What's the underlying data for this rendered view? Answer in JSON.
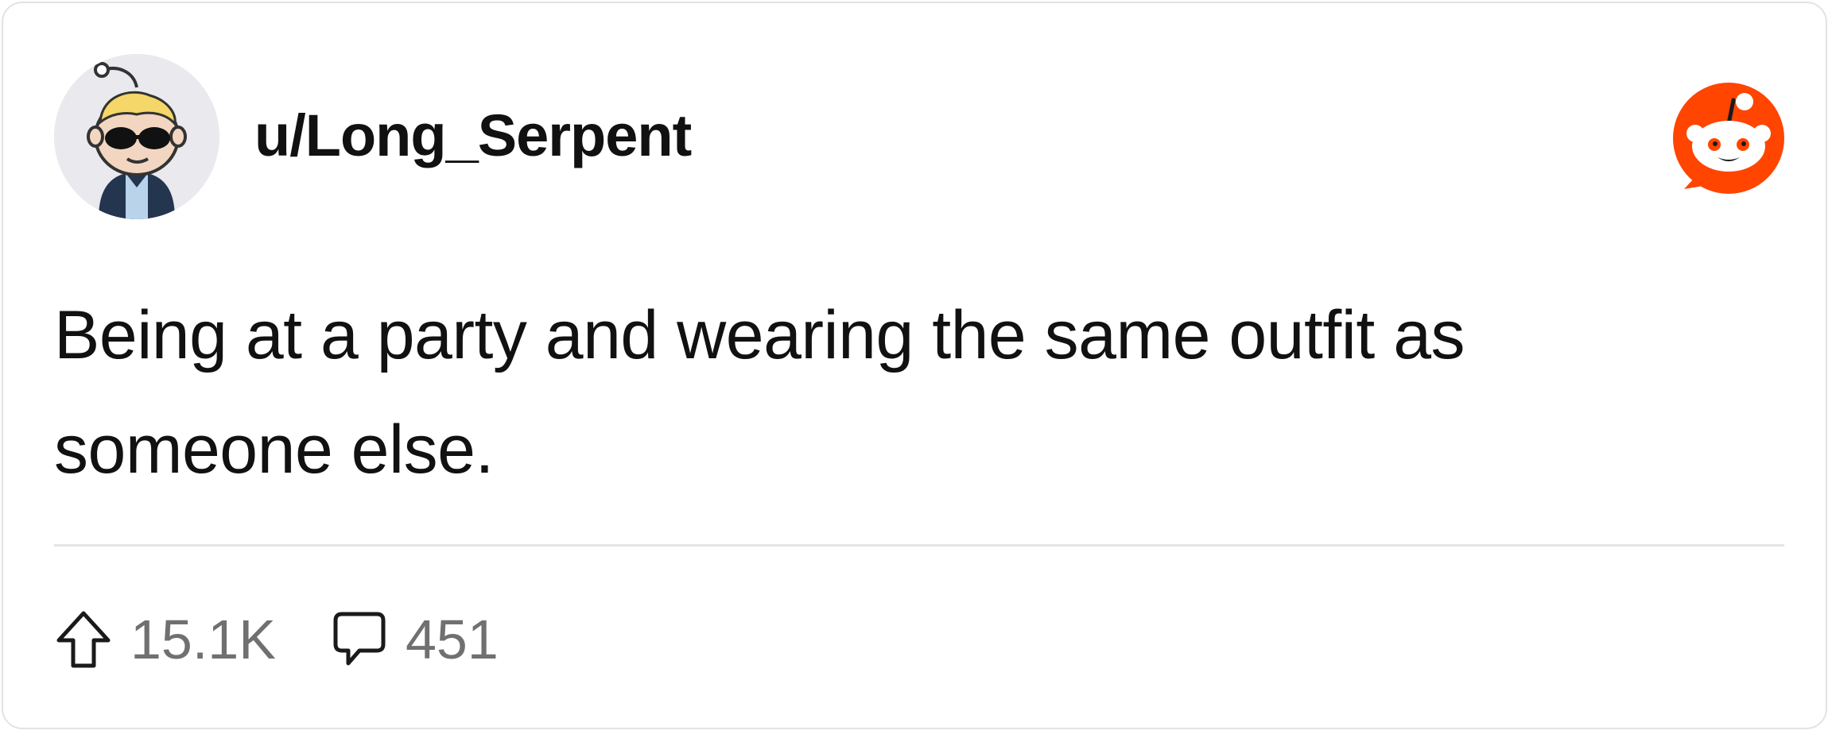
{
  "post": {
    "username": "u/Long_Serpent",
    "text": "Being at a party and wearing the same outfit as someone else."
  },
  "stats": {
    "upvotes": "15.1K",
    "comments": "451"
  },
  "icons": {
    "avatar": "snoo-avatar-with-sunglasses",
    "brand": "reddit-logo-icon",
    "upvote": "upvote-arrow-icon",
    "comment": "comment-bubble-icon"
  },
  "colors": {
    "brand": "#ff4500",
    "text": "#111111",
    "muted": "#707070",
    "divider": "#e4e4e4"
  }
}
